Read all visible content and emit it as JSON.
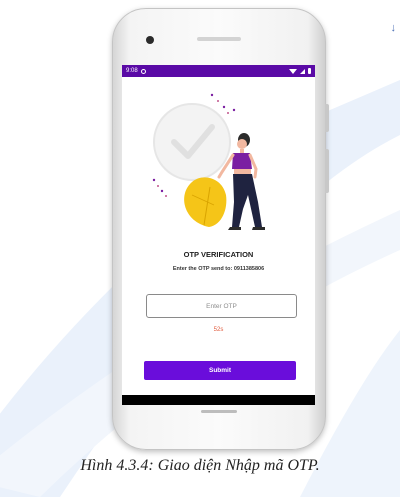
{
  "figure": {
    "caption": "Hình 4.3.4: Giao diện Nhập mã OTP.",
    "corner_glyph": "↓"
  },
  "status_bar": {
    "time": "9:08",
    "icons": [
      "g-icon",
      "wifi-icon",
      "signal-icon",
      "battery-icon"
    ],
    "color": "#5a0aa6"
  },
  "illustration": {
    "description_icon": "woman-with-check-icon",
    "colors": {
      "purple": "#7b1fa2",
      "yellow": "#f5c518",
      "check_circle": "#e9e9e9"
    }
  },
  "otp": {
    "title": "OTP VERIFICATION",
    "subtitle": "Enter the OTP send to: 0911385806",
    "input_placeholder": "Enter OTP",
    "input_value": "",
    "timer": "52s",
    "submit_label": "Submit"
  },
  "colors": {
    "accent": "#6a0ddb",
    "timer": "#e05a3c",
    "nav_bar": "#000000"
  }
}
